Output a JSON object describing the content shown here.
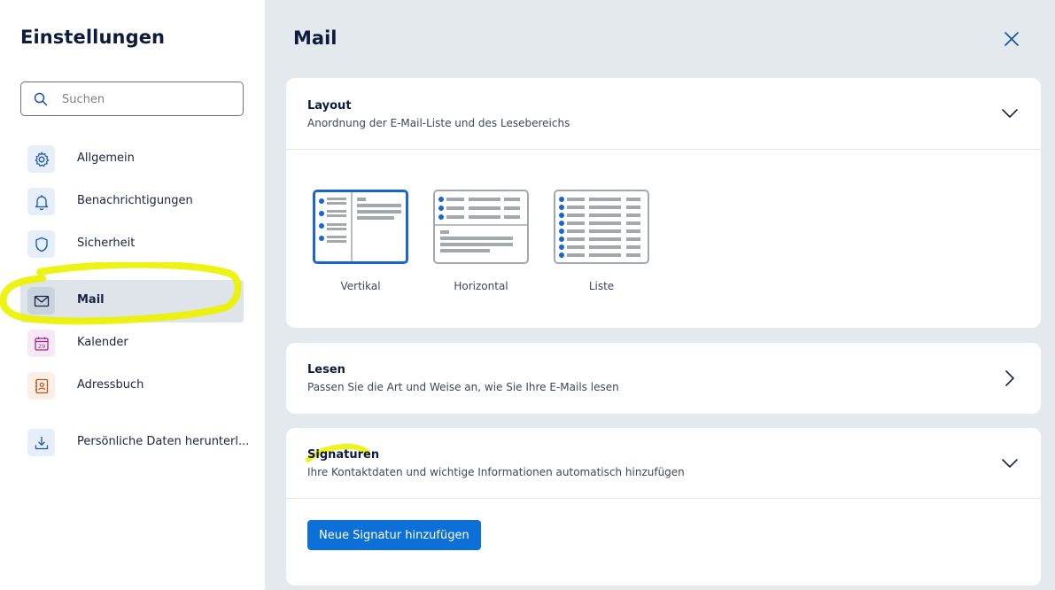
{
  "sidebar": {
    "title": "Einstellungen",
    "search_placeholder": "Suchen",
    "items": [
      {
        "label": "Allgemein",
        "icon": "gear-icon"
      },
      {
        "label": "Benachrichtigungen",
        "icon": "bell-icon"
      },
      {
        "label": "Sicherheit",
        "icon": "shield-icon"
      },
      {
        "label": "Mail",
        "icon": "envelope-icon",
        "active": true
      },
      {
        "label": "Kalender",
        "icon": "calendar-icon",
        "badge": "29"
      },
      {
        "label": "Adressbuch",
        "icon": "address-book-icon"
      },
      {
        "label": "Persönliche Daten herunterl...",
        "icon": "download-icon"
      }
    ]
  },
  "main": {
    "title": "Mail",
    "close_icon": "close-icon"
  },
  "layout_card": {
    "title": "Layout",
    "subtitle": "Anordnung der E-Mail-Liste und des Lesebereichs",
    "options": [
      {
        "label": "Vertikal",
        "selected": true
      },
      {
        "label": "Horizontal",
        "selected": false
      },
      {
        "label": "Liste",
        "selected": false
      }
    ]
  },
  "read_card": {
    "title": "Lesen",
    "subtitle": "Passen Sie die Art und Weise an, wie Sie Ihre E-Mails lesen"
  },
  "signature_card": {
    "title": "Signaturen",
    "subtitle": "Ihre Kontaktdaten und wichtige Informationen automatisch hinzufügen",
    "add_button": "Neue Signatur hinzufügen"
  },
  "colors": {
    "accent": "#0d6fd8",
    "selected_border": "#1866cf",
    "highlight": "#ecf200"
  }
}
